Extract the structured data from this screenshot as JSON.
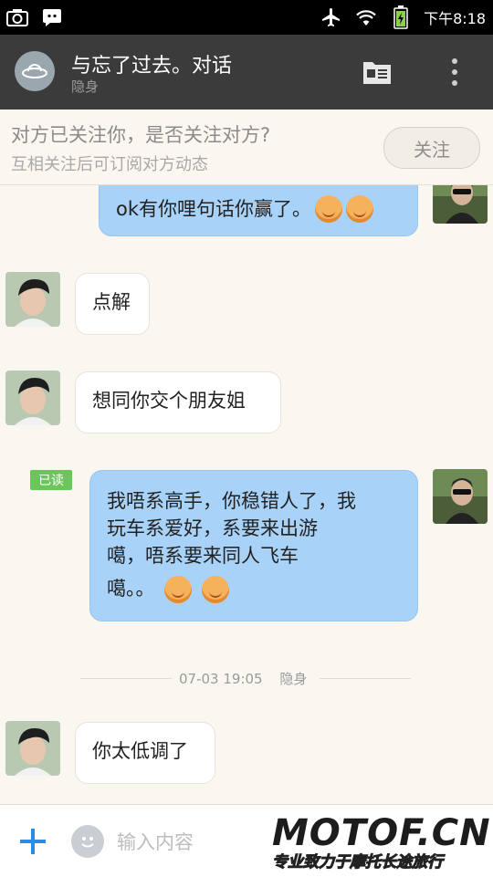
{
  "status_bar": {
    "time": "下午8:18",
    "left_icons": [
      "camera-icon",
      "message-icon"
    ],
    "right_icons": [
      "airplane-icon",
      "wifi-icon",
      "battery-icon"
    ]
  },
  "header": {
    "title": "与忘了过去。对话",
    "subtitle": "隐身",
    "icons": [
      "profile-card-icon",
      "more-icon"
    ]
  },
  "follow_banner": {
    "line1": "对方已关注你，是否关注对方?",
    "line2": "互相关注后可订阅对方动态",
    "button_label": "关注"
  },
  "messages": [
    {
      "direction": "out",
      "text": "ok有你哩句话你赢了。",
      "emoji_count": 2
    },
    {
      "direction": "in",
      "text": "点解"
    },
    {
      "direction": "in",
      "text": "想同你交个朋友姐"
    },
    {
      "direction": "out",
      "read_label": "已读",
      "lines": [
        "我唔系高手，你稳错人了，我",
        "玩车系爱好，系要来出游",
        "噶，唔系要来同人飞车",
        "噶。。"
      ],
      "emoji_count": 2
    },
    {
      "direction": "in",
      "text": "你太低调了"
    }
  ],
  "divider": {
    "time": "07-03 19:05",
    "status": "隐身"
  },
  "input_bar": {
    "placeholder": "输入内容",
    "icons": [
      "plus-icon",
      "emoji-icon"
    ]
  },
  "watermark": {
    "brand": "MOTOF.CN",
    "slogan": "专业致力于摩托长途旅行"
  },
  "colors": {
    "header_bg": "#3b3b3b",
    "chat_bg": "#faf6f0",
    "out_bubble": "#a8d2f8",
    "in_bubble": "#ffffff",
    "read_badge": "#6cc55a",
    "accent": "#2a8be8"
  }
}
